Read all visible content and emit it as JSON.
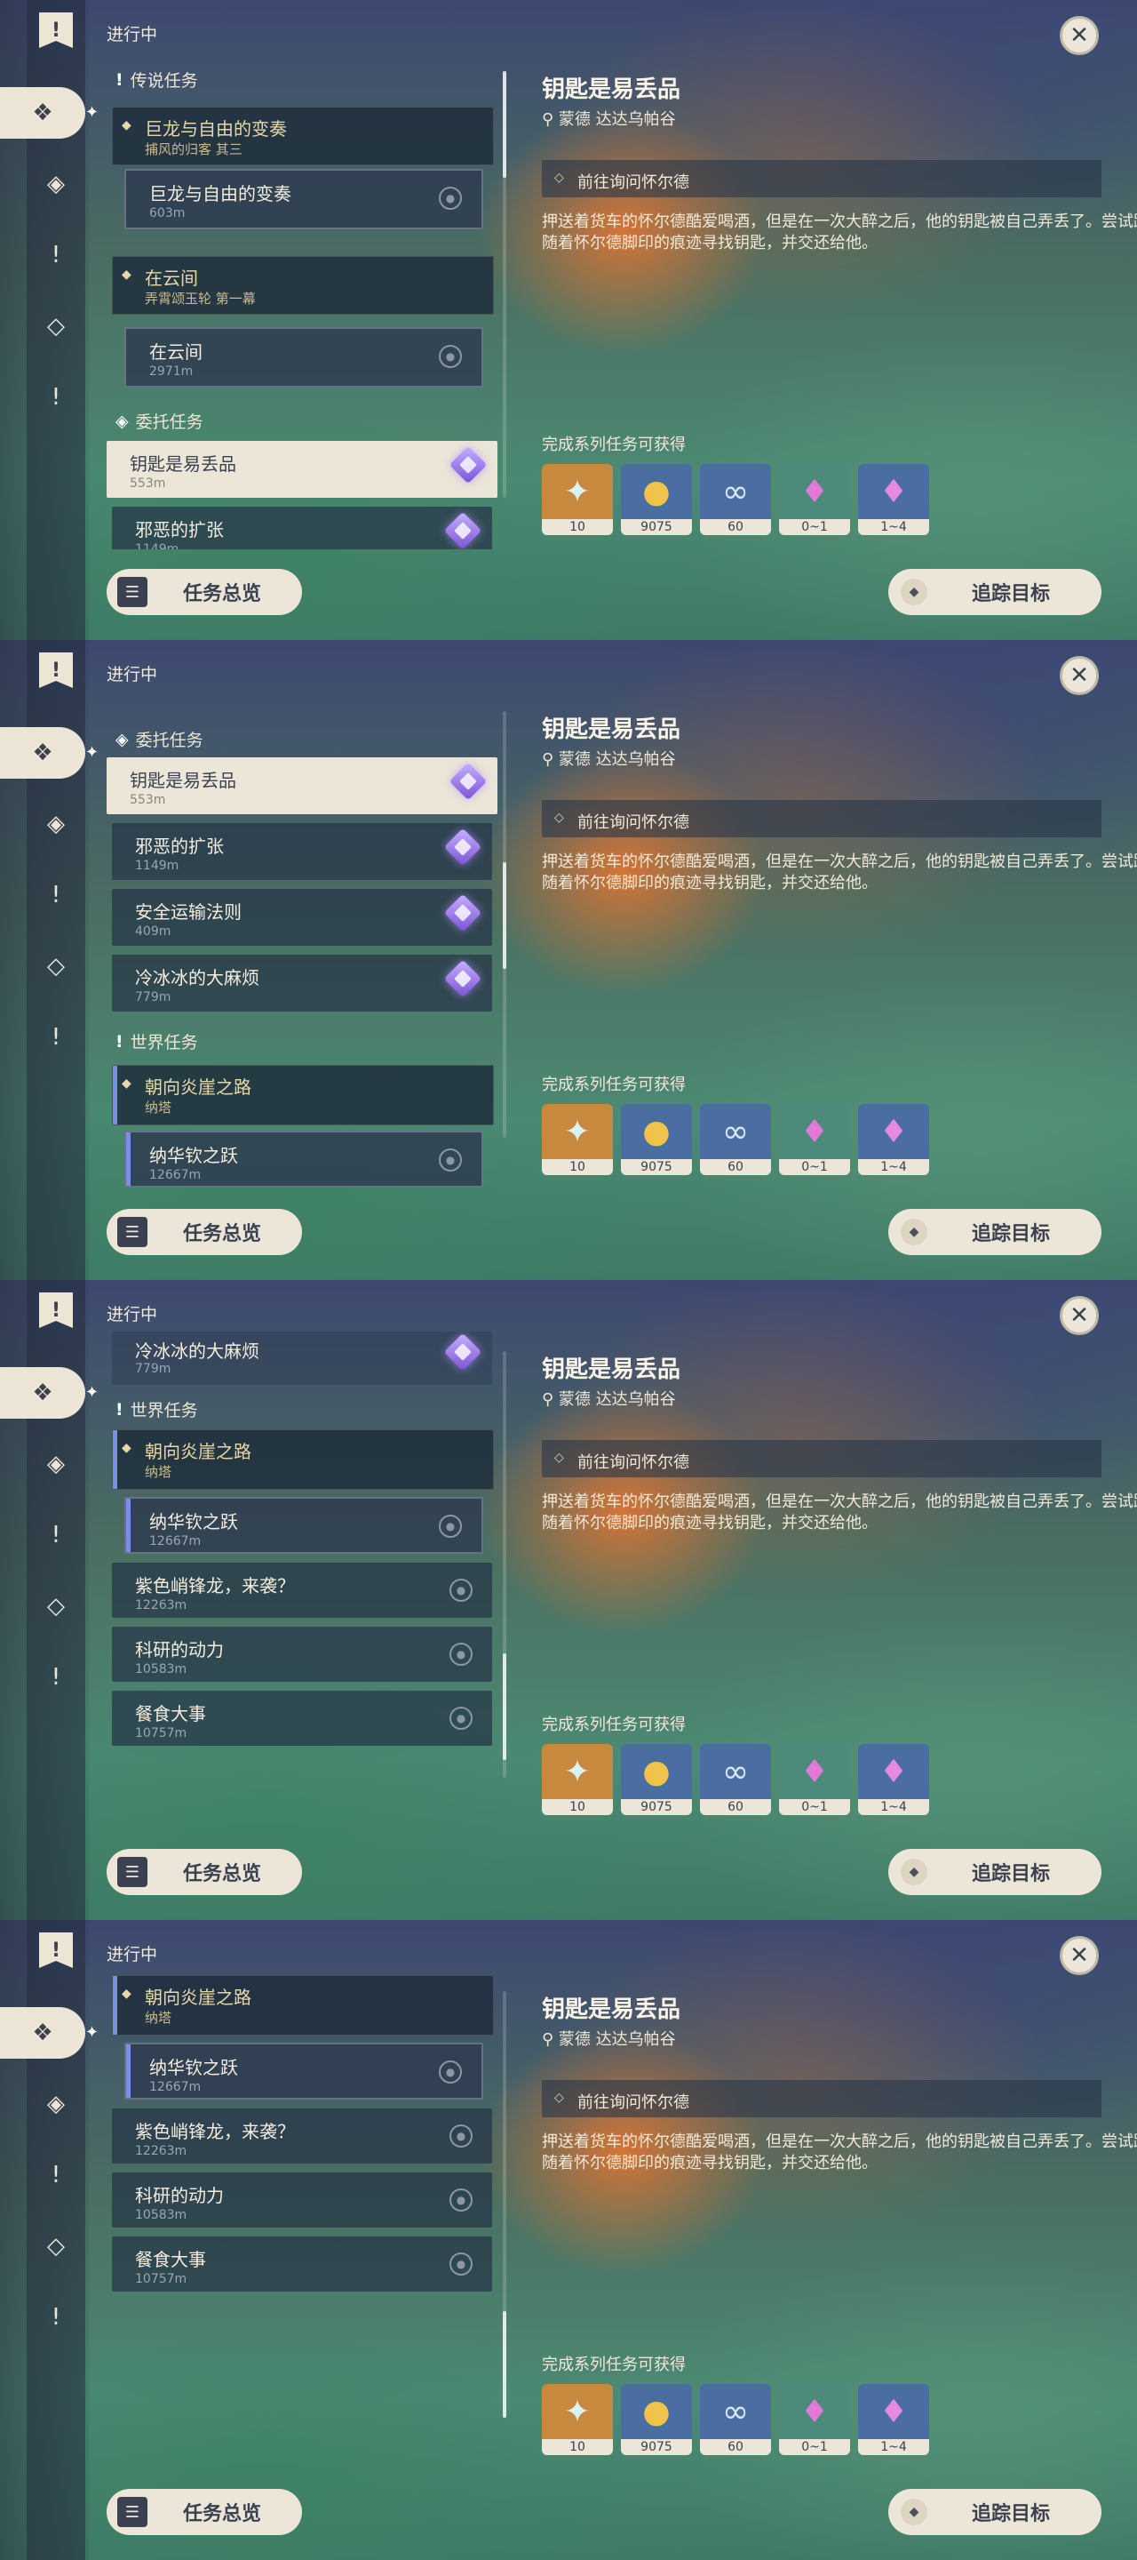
{
  "header": "进行中",
  "overview_button": "任务总览",
  "track_button": "追踪目标",
  "close_icon": "close-icon",
  "detail": {
    "title": "钥匙是易丢品",
    "location": "蒙德 达达乌帕谷",
    "objective": "前往询问怀尔德",
    "description": "押送着货车的怀尔德酷爱喝酒，但是在一次大醉之后，他的钥匙被自己弄丢了。尝试跟随着怀尔德脚印的痕迹寻找钥匙，并交还给他。",
    "rewards_label": "完成系列任务可获得",
    "rewards": [
      {
        "icon": "adventure-exp-icon",
        "count": "10"
      },
      {
        "icon": "mora-icon",
        "count": "9075"
      },
      {
        "icon": "companionship-exp-icon",
        "count": "60"
      },
      {
        "icon": "crystal-chunk-icon",
        "count": "0~1"
      },
      {
        "icon": "crystal-cluster-icon",
        "count": "1~4"
      }
    ]
  },
  "categories": {
    "legend": "传说任务",
    "commission": "委托任务",
    "world": "世界任务"
  },
  "quests": {
    "dragon": {
      "title": "巨龙与自由的变奏",
      "sub": "捕风的归客 其三"
    },
    "dragon_step": {
      "title": "巨龙与自由的变奏",
      "dist": "603m"
    },
    "cloud": {
      "title": "在云间",
      "sub": "弄霄颂玉轮 第一幕"
    },
    "cloud_step": {
      "title": "在云间",
      "dist": "2971m"
    },
    "key": {
      "title": "钥匙是易丢品",
      "dist": "553m"
    },
    "evil": {
      "title": "邪恶的扩张",
      "dist": "1149m"
    },
    "safe": {
      "title": "安全运输法则",
      "dist": "409m"
    },
    "ice": {
      "title": "冷冰冰的大麻烦",
      "dist": "779m"
    },
    "cliff": {
      "title": "朝向炎崖之路",
      "sub": "纳塔"
    },
    "cliff_step": {
      "title": "纳华钦之跃",
      "dist": "12667m"
    },
    "purple": {
      "title": "紫色峭锋龙，来袭？",
      "dist": "12263m"
    },
    "research": {
      "title": "科研的动力",
      "dist": "10583m"
    },
    "food": {
      "title": "餐食大事",
      "dist": "10757m"
    }
  }
}
